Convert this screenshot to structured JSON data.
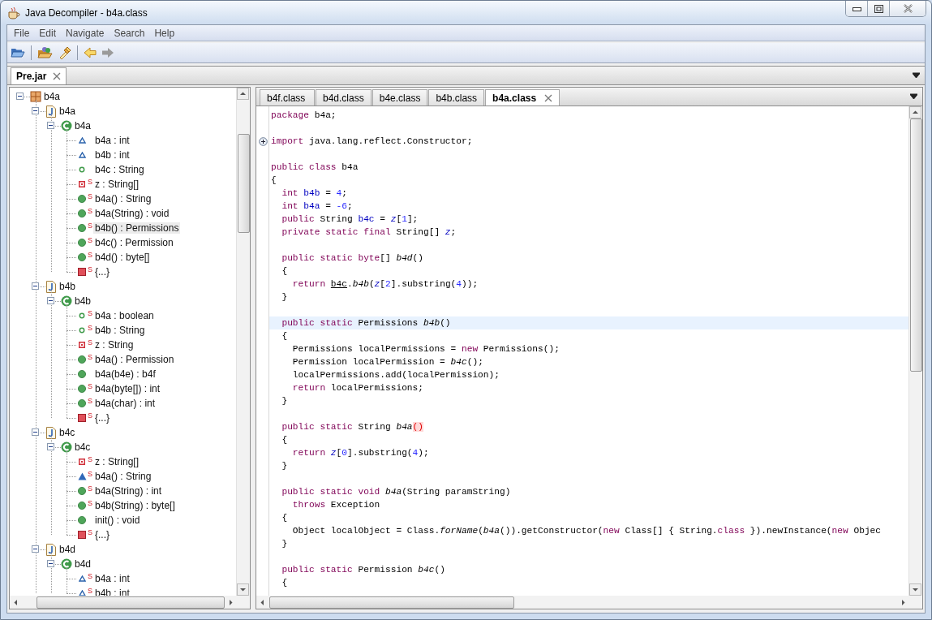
{
  "window": {
    "title": "Java Decompiler - b4a.class"
  },
  "menu": [
    "File",
    "Edit",
    "Navigate",
    "Search",
    "Help"
  ],
  "toolbar": [
    {
      "kind": "open",
      "disabled": false
    },
    {
      "kind": "separator"
    },
    {
      "kind": "open-type",
      "disabled": false
    },
    {
      "kind": "search",
      "disabled": false
    },
    {
      "kind": "separator"
    },
    {
      "kind": "back",
      "disabled": false
    },
    {
      "kind": "forward",
      "disabled": true
    }
  ],
  "file_tabs": [
    {
      "label": "Pre.jar",
      "selected": true
    }
  ],
  "tree": [
    {
      "label": "b4a",
      "kind": "package",
      "expanded": true,
      "selected": false,
      "children": [
        {
          "label": "b4a",
          "kind": "file",
          "expanded": true,
          "selected": false,
          "children": [
            {
              "label": "b4a",
              "kind": "class",
              "expanded": true,
              "selected": false,
              "children": [
                {
                  "label": "b4a : int",
                  "kind": "field-default",
                  "selected": false
                },
                {
                  "label": "b4b : int",
                  "kind": "field-default",
                  "selected": false
                },
                {
                  "label": "b4c : String",
                  "kind": "field-public",
                  "selected": false
                },
                {
                  "label": "z : String[]",
                  "kind": "field-private",
                  "badge": "S",
                  "selected": false
                },
                {
                  "label": "b4a() : String",
                  "kind": "method-public",
                  "badge": "S",
                  "selected": false
                },
                {
                  "label": "b4a(String) : void",
                  "kind": "method-public",
                  "badge": "S",
                  "selected": false
                },
                {
                  "label": "b4b() : Permissions",
                  "kind": "method-public",
                  "badge": "S",
                  "selected": true
                },
                {
                  "label": "b4c() : Permission",
                  "kind": "method-public",
                  "badge": "S",
                  "selected": false
                },
                {
                  "label": "b4d() : byte[]",
                  "kind": "method-public",
                  "badge": "S",
                  "selected": false
                },
                {
                  "label": "{...}",
                  "kind": "init",
                  "badge": "S",
                  "selected": false
                }
              ]
            }
          ]
        },
        {
          "label": "b4b",
          "kind": "file",
          "expanded": true,
          "selected": false,
          "children": [
            {
              "label": "b4b",
              "kind": "class",
              "expanded": true,
              "selected": false,
              "children": [
                {
                  "label": "b4a : boolean",
                  "kind": "field-public",
                  "badge": "S",
                  "selected": false
                },
                {
                  "label": "b4b : String",
                  "kind": "field-public",
                  "badge": "S",
                  "selected": false
                },
                {
                  "label": "z : String",
                  "kind": "field-private",
                  "badge": "S",
                  "selected": false
                },
                {
                  "label": "b4a() : Permission",
                  "kind": "method-public",
                  "badge": "S",
                  "selected": false
                },
                {
                  "label": "b4a(b4e) : b4f",
                  "kind": "method-public",
                  "selected": false
                },
                {
                  "label": "b4a(byte[]) : int",
                  "kind": "method-public",
                  "badge": "S",
                  "selected": false
                },
                {
                  "label": "b4a(char) : int",
                  "kind": "method-public",
                  "badge": "S",
                  "selected": false
                },
                {
                  "label": "{...}",
                  "kind": "init",
                  "badge": "S",
                  "selected": false
                }
              ]
            }
          ]
        },
        {
          "label": "b4c",
          "kind": "file",
          "expanded": true,
          "selected": false,
          "children": [
            {
              "label": "b4c",
              "kind": "class",
              "expanded": true,
              "selected": false,
              "children": [
                {
                  "label": "z : String[]",
                  "kind": "field-private",
                  "badge": "S",
                  "selected": false
                },
                {
                  "label": "b4a() : String",
                  "kind": "method-default",
                  "badge": "S",
                  "selected": false
                },
                {
                  "label": "b4a(String) : int",
                  "kind": "method-public",
                  "badge": "S",
                  "selected": false
                },
                {
                  "label": "b4b(String) : byte[]",
                  "kind": "method-public",
                  "badge": "S",
                  "selected": false
                },
                {
                  "label": "init() : void",
                  "kind": "method-public",
                  "selected": false
                },
                {
                  "label": "{...}",
                  "kind": "init",
                  "badge": "S",
                  "selected": false
                }
              ]
            }
          ]
        },
        {
          "label": "b4d",
          "kind": "file",
          "expanded": true,
          "selected": false,
          "children": [
            {
              "label": "b4d",
              "kind": "class",
              "expanded": true,
              "selected": false,
              "children": [
                {
                  "label": "b4a : int",
                  "kind": "field-default",
                  "badge": "S",
                  "selected": false
                },
                {
                  "label": "b4b : int",
                  "kind": "field-default",
                  "badge": "S",
                  "selected": false
                }
              ]
            }
          ]
        }
      ]
    }
  ],
  "editor_tabs": [
    {
      "label": "b4f.class",
      "selected": false
    },
    {
      "label": "b4d.class",
      "selected": false
    },
    {
      "label": "b4e.class",
      "selected": false
    },
    {
      "label": "b4b.class",
      "selected": false
    },
    {
      "label": "b4a.class",
      "selected": true
    }
  ],
  "code": [
    {
      "fold": false,
      "current": false,
      "tokens": [
        {
          "kind": "keyword",
          "text": "package"
        },
        {
          "kind": "plain",
          "text": " b4a;"
        }
      ]
    },
    {
      "fold": false,
      "current": false
    },
    {
      "fold": true,
      "current": false,
      "tokens": [
        {
          "kind": "keyword",
          "text": "import"
        },
        {
          "kind": "plain",
          "text": " java.lang.reflect.Constructor;"
        }
      ]
    },
    {
      "fold": false,
      "current": false
    },
    {
      "fold": false,
      "current": false,
      "tokens": [
        {
          "kind": "keyword",
          "text": "public class"
        },
        {
          "kind": "plain",
          "text": " b4a"
        }
      ]
    },
    {
      "fold": false,
      "current": false,
      "tokens": [
        {
          "kind": "plain",
          "text": "{"
        }
      ]
    },
    {
      "fold": false,
      "current": false,
      "tokens": [
        {
          "kind": "keyword",
          "text": "  int "
        },
        {
          "kind": "field",
          "text": "b4b"
        },
        {
          "kind": "plain",
          "text": " = "
        },
        {
          "kind": "number",
          "text": "4"
        },
        {
          "kind": "plain",
          "text": ";"
        }
      ]
    },
    {
      "fold": false,
      "current": false,
      "tokens": [
        {
          "kind": "keyword",
          "text": "  int "
        },
        {
          "kind": "field",
          "text": "b4a"
        },
        {
          "kind": "plain",
          "text": " = "
        },
        {
          "kind": "number",
          "text": "-6"
        },
        {
          "kind": "plain",
          "text": ";"
        }
      ]
    },
    {
      "fold": false,
      "current": false,
      "tokens": [
        {
          "kind": "keyword",
          "text": "  public"
        },
        {
          "kind": "plain",
          "text": " String "
        },
        {
          "kind": "field",
          "text": "b4c"
        },
        {
          "kind": "plain",
          "text": " = "
        },
        {
          "kind": "static-field",
          "text": "z"
        },
        {
          "kind": "plain",
          "text": "["
        },
        {
          "kind": "number",
          "text": "1"
        },
        {
          "kind": "plain",
          "text": "];"
        }
      ]
    },
    {
      "fold": false,
      "current": false,
      "tokens": [
        {
          "kind": "keyword",
          "text": "  private static final"
        },
        {
          "kind": "plain",
          "text": " String[] "
        },
        {
          "kind": "static-field",
          "text": "z"
        },
        {
          "kind": "plain",
          "text": ";"
        }
      ]
    },
    {
      "fold": false,
      "current": false
    },
    {
      "fold": false,
      "current": false,
      "tokens": [
        {
          "kind": "keyword",
          "text": "  public static byte"
        },
        {
          "kind": "plain",
          "text": "[] "
        },
        {
          "kind": "method",
          "text": "b4d"
        },
        {
          "kind": "plain",
          "text": "()"
        }
      ]
    },
    {
      "fold": false,
      "current": false,
      "tokens": [
        {
          "kind": "plain",
          "text": "  {"
        }
      ]
    },
    {
      "fold": false,
      "current": false,
      "tokens": [
        {
          "kind": "keyword",
          "text": "    return "
        },
        {
          "kind": "link",
          "text": "b4c"
        },
        {
          "kind": "plain",
          "text": "."
        },
        {
          "kind": "method",
          "text": "b4b"
        },
        {
          "kind": "plain",
          "text": "("
        },
        {
          "kind": "static-field",
          "text": "z"
        },
        {
          "kind": "plain",
          "text": "["
        },
        {
          "kind": "number",
          "text": "2"
        },
        {
          "kind": "plain",
          "text": "].substring("
        },
        {
          "kind": "number",
          "text": "4"
        },
        {
          "kind": "plain",
          "text": "));"
        }
      ]
    },
    {
      "fold": false,
      "current": false,
      "tokens": [
        {
          "kind": "plain",
          "text": "  }"
        }
      ]
    },
    {
      "fold": false,
      "current": false
    },
    {
      "fold": false,
      "current": true,
      "tokens": [
        {
          "kind": "keyword",
          "text": "  public static"
        },
        {
          "kind": "plain",
          "text": " Permissions "
        },
        {
          "kind": "method",
          "text": "b4b"
        },
        {
          "kind": "plain",
          "text": "()"
        }
      ]
    },
    {
      "fold": false,
      "current": false,
      "tokens": [
        {
          "kind": "plain",
          "text": "  {"
        }
      ]
    },
    {
      "fold": false,
      "current": false,
      "tokens": [
        {
          "kind": "plain",
          "text": "    Permissions localPermissions = "
        },
        {
          "kind": "keyword",
          "text": "new"
        },
        {
          "kind": "plain",
          "text": " Permissions();"
        }
      ]
    },
    {
      "fold": false,
      "current": false,
      "tokens": [
        {
          "kind": "plain",
          "text": "    Permission localPermission = "
        },
        {
          "kind": "method",
          "text": "b4c"
        },
        {
          "kind": "plain",
          "text": "();"
        }
      ]
    },
    {
      "fold": false,
      "current": false,
      "tokens": [
        {
          "kind": "plain",
          "text": "    localPermissions.add(localPermission);"
        }
      ]
    },
    {
      "fold": false,
      "current": false,
      "tokens": [
        {
          "kind": "keyword",
          "text": "    return"
        },
        {
          "kind": "plain",
          "text": " localPermissions;"
        }
      ]
    },
    {
      "fold": false,
      "current": false,
      "tokens": [
        {
          "kind": "plain",
          "text": "  }"
        }
      ]
    },
    {
      "fold": false,
      "current": false
    },
    {
      "fold": false,
      "current": false,
      "tokens": [
        {
          "kind": "keyword",
          "text": "  public static"
        },
        {
          "kind": "plain",
          "text": " String "
        },
        {
          "kind": "method",
          "text": "b4a"
        },
        {
          "kind": "error",
          "text": "()"
        }
      ]
    },
    {
      "fold": false,
      "current": false,
      "tokens": [
        {
          "kind": "plain",
          "text": "  {"
        }
      ]
    },
    {
      "fold": false,
      "current": false,
      "tokens": [
        {
          "kind": "keyword",
          "text": "    return "
        },
        {
          "kind": "static-field",
          "text": "z"
        },
        {
          "kind": "plain",
          "text": "["
        },
        {
          "kind": "number",
          "text": "0"
        },
        {
          "kind": "plain",
          "text": "].substring("
        },
        {
          "kind": "number",
          "text": "4"
        },
        {
          "kind": "plain",
          "text": ");"
        }
      ]
    },
    {
      "fold": false,
      "current": false,
      "tokens": [
        {
          "kind": "plain",
          "text": "  }"
        }
      ]
    },
    {
      "fold": false,
      "current": false
    },
    {
      "fold": false,
      "current": false,
      "tokens": [
        {
          "kind": "keyword",
          "text": "  public static void "
        },
        {
          "kind": "method",
          "text": "b4a"
        },
        {
          "kind": "plain",
          "text": "(String paramString)"
        }
      ]
    },
    {
      "fold": false,
      "current": false,
      "tokens": [
        {
          "kind": "keyword",
          "text": "    throws"
        },
        {
          "kind": "plain",
          "text": " Exception"
        }
      ]
    },
    {
      "fold": false,
      "current": false,
      "tokens": [
        {
          "kind": "plain",
          "text": "  {"
        }
      ]
    },
    {
      "fold": false,
      "current": false,
      "tokens": [
        {
          "kind": "plain",
          "text": "    Object localObject = Class."
        },
        {
          "kind": "method",
          "text": "forName"
        },
        {
          "kind": "plain",
          "text": "("
        },
        {
          "kind": "method",
          "text": "b4a"
        },
        {
          "kind": "plain",
          "text": "()).getConstructor("
        },
        {
          "kind": "keyword",
          "text": "new"
        },
        {
          "kind": "plain",
          "text": " Class[] { String."
        },
        {
          "kind": "keyword",
          "text": "class"
        },
        {
          "kind": "plain",
          "text": " }).newInstance("
        },
        {
          "kind": "keyword",
          "text": "new"
        },
        {
          "kind": "plain",
          "text": " Objec"
        }
      ]
    },
    {
      "fold": false,
      "current": false,
      "tokens": [
        {
          "kind": "plain",
          "text": "  }"
        }
      ]
    },
    {
      "fold": false,
      "current": false
    },
    {
      "fold": false,
      "current": false,
      "tokens": [
        {
          "kind": "keyword",
          "text": "  public static"
        },
        {
          "kind": "plain",
          "text": " Permission "
        },
        {
          "kind": "method",
          "text": "b4c"
        },
        {
          "kind": "plain",
          "text": "()"
        }
      ]
    },
    {
      "fold": false,
      "current": false,
      "tokens": [
        {
          "kind": "plain",
          "text": "  {"
        }
      ]
    }
  ]
}
